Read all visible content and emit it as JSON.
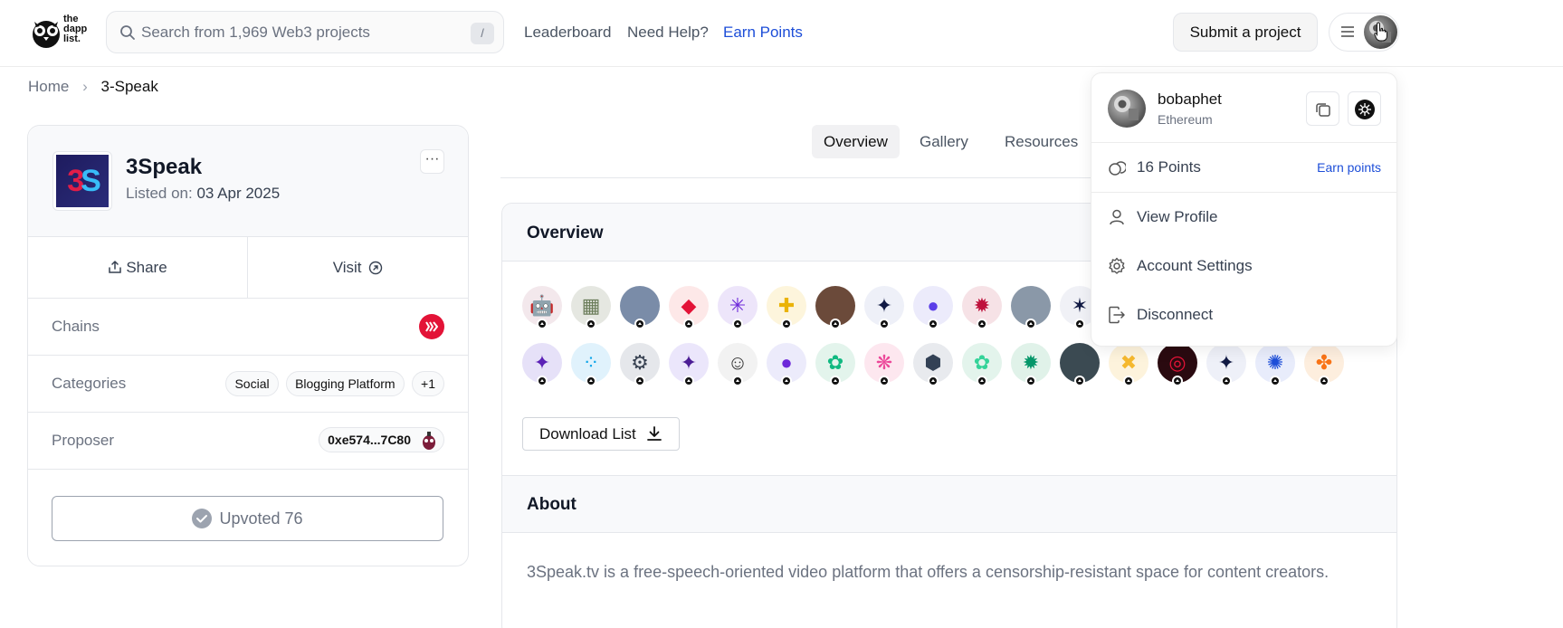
{
  "header": {
    "logo_text_line1": "the",
    "logo_text_line2": "dapp",
    "logo_text_line3": "list.",
    "search_placeholder": "Search from 1,969 Web3 projects",
    "search_shortcut": "/",
    "nav": {
      "leaderboard": "Leaderboard",
      "need_help": "Need Help?",
      "earn_points": "Earn Points"
    },
    "submit_label": "Submit a project",
    "accent_color": "#1d4ed8"
  },
  "breadcrumb": {
    "home": "Home",
    "current": "3-Speak"
  },
  "project": {
    "name": "3Speak",
    "listed_label": "Listed on:",
    "listed_date": "03 Apr 2025",
    "share_label": "Share",
    "visit_label": "Visit",
    "chains_label": "Chains",
    "chain_icon": "hive-icon",
    "categories_label": "Categories",
    "categories": [
      "Social",
      "Blogging Platform"
    ],
    "categories_more": "+1",
    "proposer_label": "Proposer",
    "proposer_address": "0xe574...7C80",
    "upvoted_label": "Upvoted 76"
  },
  "tabs": [
    "Overview",
    "Gallery",
    "Resources"
  ],
  "overview": {
    "title": "Overview",
    "download_label": "Download List",
    "voters_row1": [
      {
        "name": "robot-avatar",
        "bg": "#f3e8ec",
        "fg": "#7c1d3a",
        "glyph": "🤖"
      },
      {
        "name": "green-squares-avatar",
        "bg": "#e5e7e1",
        "fg": "#6b7d5a",
        "glyph": "▦"
      },
      {
        "name": "photo-avatar",
        "bg": "#7a8ca8",
        "fg": "#fff",
        "glyph": ""
      },
      {
        "name": "hive-avatar",
        "bg": "#fde8e8",
        "fg": "#e31337",
        "glyph": "◆"
      },
      {
        "name": "purple-burst-avatar",
        "bg": "#ede5fa",
        "fg": "#6d28d9",
        "glyph": "✳"
      },
      {
        "name": "yellow-cross-avatar",
        "bg": "#fdf5dc",
        "fg": "#eab308",
        "glyph": "✚"
      },
      {
        "name": "face-avatar",
        "bg": "#6b4a3a",
        "fg": "#fff",
        "glyph": ""
      },
      {
        "name": "navy-star-avatar",
        "bg": "#eef0f8",
        "fg": "#111a44",
        "glyph": "✦"
      },
      {
        "name": "purple-circle-avatar",
        "bg": "#ecebfb",
        "fg": "#5b3ee8",
        "glyph": "●"
      },
      {
        "name": "crimson-badge-avatar",
        "bg": "#f6e2e6",
        "fg": "#be123c",
        "glyph": "✹"
      },
      {
        "name": "bee-avatar",
        "bg": "#8a98a8",
        "fg": "#fff",
        "glyph": ""
      },
      {
        "name": "dark-star-avatar",
        "bg": "#f0f1f6",
        "fg": "#111a44",
        "glyph": "✶"
      }
    ],
    "voters_row2": [
      {
        "name": "violet-sparkle-avatar",
        "bg": "#e6e1f8",
        "fg": "#5b21b6",
        "glyph": "✦"
      },
      {
        "name": "blue-dots-avatar",
        "bg": "#e0f2fc",
        "fg": "#0ea5e9",
        "glyph": "⁘"
      },
      {
        "name": "gear-dark-avatar",
        "bg": "#e5e7eb",
        "fg": "#374151",
        "glyph": "⚙"
      },
      {
        "name": "indigo-sparkle-avatar",
        "bg": "#ebe6fb",
        "fg": "#4c1d95",
        "glyph": "✦"
      },
      {
        "name": "sketch-face-avatar",
        "bg": "#f2f2f2",
        "fg": "#333",
        "glyph": "☺"
      },
      {
        "name": "violet-circle-avatar",
        "bg": "#ecebfb",
        "fg": "#6d28d9",
        "glyph": "●"
      },
      {
        "name": "teal-gear-avatar",
        "bg": "#e3f4ec",
        "fg": "#10b981",
        "glyph": "✿"
      },
      {
        "name": "pink-flower-avatar",
        "bg": "#fde7ef",
        "fg": "#ec4899",
        "glyph": "❋"
      },
      {
        "name": "slate-blob-avatar",
        "bg": "#e8eaee",
        "fg": "#334155",
        "glyph": "⬢"
      },
      {
        "name": "mint-gear-avatar",
        "bg": "#e3f4ec",
        "fg": "#34d399",
        "glyph": "✿"
      },
      {
        "name": "green-badge-avatar",
        "bg": "#e0f2e9",
        "fg": "#059669",
        "glyph": "✹"
      },
      {
        "name": "person-photo-avatar",
        "bg": "#3b4a52",
        "fg": "#fff",
        "glyph": ""
      },
      {
        "name": "yellow-x-avatar",
        "bg": "#fdf3dc",
        "fg": "#f5b82e",
        "glyph": "✖"
      },
      {
        "name": "red-ring-avatar",
        "bg": "#2a0a10",
        "fg": "#e31337",
        "glyph": "◎"
      },
      {
        "name": "navy-sparkle-avatar",
        "bg": "#eef0f8",
        "fg": "#111a44",
        "glyph": "✦"
      },
      {
        "name": "blue-sun-avatar",
        "bg": "#e8ecfb",
        "fg": "#1d4ed8",
        "glyph": "✺"
      },
      {
        "name": "orange-flower-avatar",
        "bg": "#fdeede",
        "fg": "#f97316",
        "glyph": "✤"
      }
    ]
  },
  "about": {
    "title": "About",
    "text": "3Speak.tv is a free-speech-oriented video platform that offers a censorship-resistant space for content creators."
  },
  "account_menu": {
    "username": "bobaphet",
    "chain": "Ethereum",
    "points": "16 Points",
    "earn_points": "Earn points",
    "view_profile": "View Profile",
    "account_settings": "Account Settings",
    "disconnect": "Disconnect"
  }
}
